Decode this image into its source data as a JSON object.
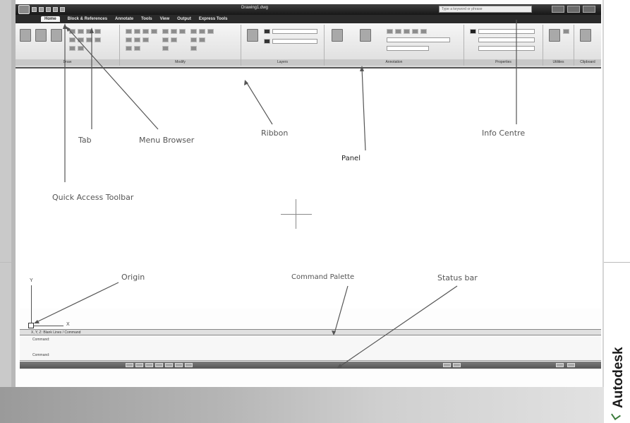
{
  "window": {
    "title": "Drawing1.dwg",
    "search_placeholder": "Type a keyword or phrase"
  },
  "tabs": [
    {
      "label": "Home",
      "active": true
    },
    {
      "label": "Block & References",
      "active": false
    },
    {
      "label": "Annotate",
      "active": false
    },
    {
      "label": "Tools",
      "active": false
    },
    {
      "label": "View",
      "active": false
    },
    {
      "label": "Output",
      "active": false
    },
    {
      "label": "Express Tools",
      "active": false
    }
  ],
  "ribbon": {
    "panels": [
      {
        "label": "Draw"
      },
      {
        "label": "Modify"
      },
      {
        "label": "Layers"
      },
      {
        "label": "Annotation"
      },
      {
        "label": "Properties"
      },
      {
        "label": "Utilities"
      },
      {
        "label": "Clipboard"
      }
    ]
  },
  "command": {
    "header": "X, Y, Z: Blank Lines / Command",
    "lines": [
      "Command:",
      "Command:"
    ]
  },
  "ucs": {
    "y_label": "Y",
    "x_label": "X"
  },
  "annotations": {
    "tab": "Tab",
    "menu_browser": "Menu Browser",
    "ribbon": "Ribbon",
    "info_centre": "Info Centre",
    "panel": "Panel",
    "quick_access": "Quick Access Toolbar",
    "origin": "Origin",
    "command_palette": "Command Palette",
    "status_bar": "Status bar"
  },
  "brand": "Autodesk",
  "colors": {
    "title_bar": "#1f1f1f",
    "ribbon": "#e6e6e6",
    "brand_mark": "#3a7a3a"
  }
}
